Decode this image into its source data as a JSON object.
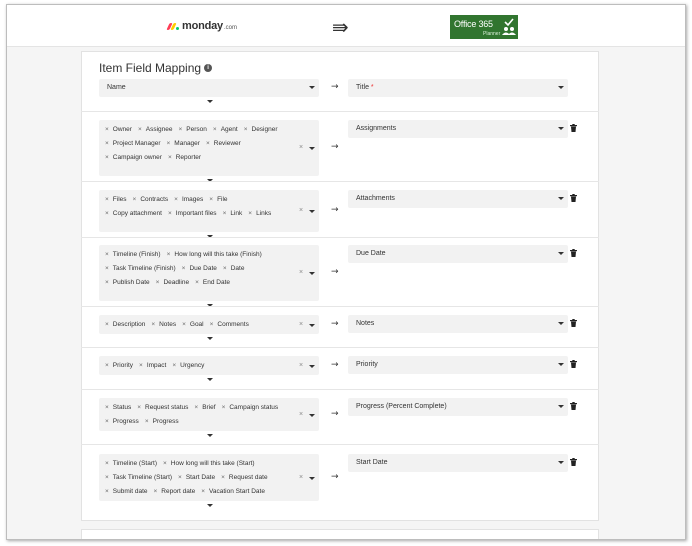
{
  "header": {
    "source_logo": {
      "word": "monday",
      "suffix": ".com",
      "colors": [
        "#ff3d57",
        "#ffcb00",
        "#00ca72"
      ]
    },
    "direction_icon": "double-arrow-right-icon",
    "target_logo": {
      "name": "Office 365",
      "sub": "Planner",
      "color": "#31752f"
    }
  },
  "section": {
    "title": "Item Field Mapping",
    "info_icon": "info-icon"
  },
  "mappings": [
    {
      "source": [
        [
          "Name"
        ]
      ],
      "target": "Title",
      "required_marker": "*",
      "deletable": false
    },
    {
      "source": [
        [
          "Owner",
          "Assignee",
          "Person",
          "Agent",
          "Designer"
        ],
        [
          "Project Manager",
          "Manager",
          "Reviewer"
        ],
        [
          "Campaign owner",
          "Reporter"
        ]
      ],
      "target": "Assignments",
      "deletable": true
    },
    {
      "source": [
        [
          "Files",
          "Contracts",
          "Images",
          "File"
        ],
        [
          "Copy attachment",
          "Important files",
          "Link",
          "Links"
        ]
      ],
      "target": "Attachments",
      "deletable": true
    },
    {
      "source": [
        [
          "Timeline (Finish)",
          "How long will this take (Finish)"
        ],
        [
          "Task Timeline (Finish)",
          "Due Date",
          "Date"
        ],
        [
          "Publish Date",
          "Deadline",
          "End Date"
        ]
      ],
      "target": "Due Date",
      "deletable": true
    },
    {
      "source": [
        [
          "Description",
          "Notes",
          "Goal",
          "Comments"
        ]
      ],
      "target": "Notes",
      "deletable": true
    },
    {
      "source": [
        [
          "Priority",
          "Impact",
          "Urgency"
        ]
      ],
      "target": "Priority",
      "deletable": true
    },
    {
      "source": [
        [
          "Status",
          "Request status",
          "Brief",
          "Campaign status"
        ],
        [
          "Progress",
          "Progress"
        ]
      ],
      "target": "Progress (Percent Complete)",
      "deletable": true
    },
    {
      "source": [
        [
          "Timeline (Start)",
          "How long will this take (Start)"
        ],
        [
          "Task Timeline (Start)",
          "Start Date",
          "Request date"
        ],
        [
          "Submit date",
          "Report date",
          "Vacation Start Date"
        ]
      ],
      "target": "Start Date",
      "deletable": true
    }
  ],
  "symbols": {
    "map_arrow": "→",
    "chip_remove": "×",
    "clear": "×",
    "direction": "⇛"
  }
}
